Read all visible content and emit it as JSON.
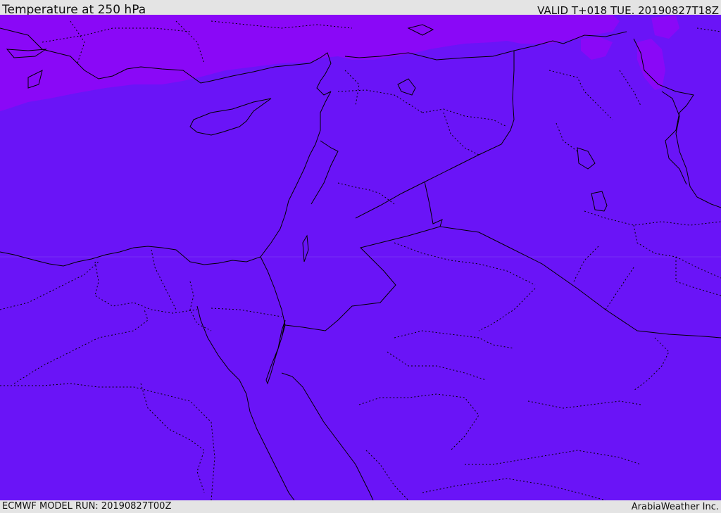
{
  "header": {
    "title": "Temperature at 250 hPa",
    "valid": "VALID T+018 TUE. 20190827T18Z"
  },
  "footer": {
    "model_run": "ECMWF MODEL RUN: 20190827T00Z",
    "credit": "ArabiaWeather Inc."
  },
  "map": {
    "field_color": "#6a14f7",
    "cold_region_color": "#8a08f7",
    "coast_color": "#000000"
  }
}
